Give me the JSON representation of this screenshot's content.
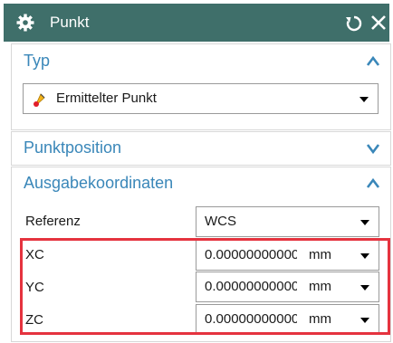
{
  "window": {
    "title": "Punkt",
    "icons": {
      "settings": "gear-icon",
      "reset": "reset-icon",
      "close": "close-icon"
    },
    "colors": {
      "titlebar": "#3f6f6a",
      "section_title": "#3a87b9",
      "highlight": "#e5333f"
    }
  },
  "typ": {
    "title": "Typ",
    "dropdown": {
      "icon": "inferred-point-icon",
      "value": "Ermittelter Punkt"
    }
  },
  "punktposition": {
    "title": "Punktposition"
  },
  "ausgabekoordinaten": {
    "title": "Ausgabekoordinaten",
    "referenz": {
      "label": "Referenz",
      "value": "WCS"
    },
    "rows": [
      {
        "label": "XC",
        "value": "0.00000000000",
        "unit": "mm"
      },
      {
        "label": "YC",
        "value": "0.00000000000",
        "unit": "mm"
      },
      {
        "label": "ZC",
        "value": "0.00000000000",
        "unit": "mm"
      }
    ]
  }
}
